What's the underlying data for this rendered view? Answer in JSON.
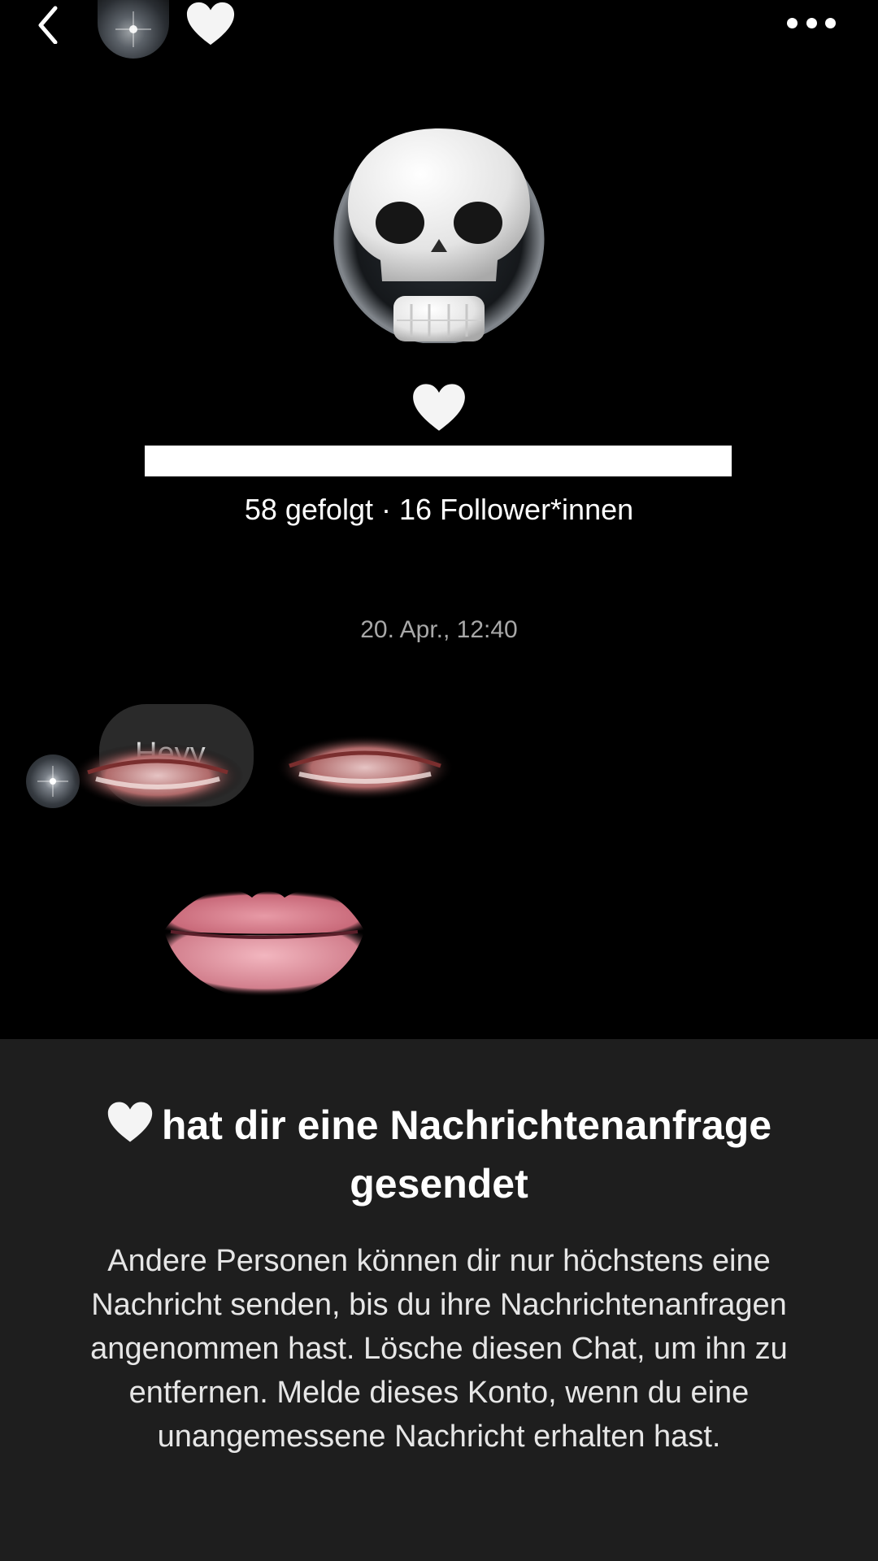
{
  "header": {
    "back_label": "back",
    "more_label": "more options"
  },
  "profile": {
    "stats": "58 gefolgt · 16 Follower*innen"
  },
  "chat": {
    "timestamp": "20. Apr., 12:40",
    "messages": [
      {
        "text": "Heyy"
      }
    ]
  },
  "request": {
    "title": "hat dir eine Nachrichtenanfrage gesendet",
    "body": "Andere Personen können dir nur höchstens eine Nachricht senden, bis du ihre Nachrichtenanfragen angenommen hast. Lösche diesen Chat, um ihn zu entfernen. Melde dieses Konto, wenn du eine unangemessene Nachricht erhalten hast."
  },
  "icons": {
    "back": "chevron-left-icon",
    "more": "ellipsis-icon",
    "heart": "white-heart-icon",
    "skull": "skull-icon"
  },
  "colors": {
    "background": "#000000",
    "panel": "#1e1e1e",
    "bubble": "#2a2a2a",
    "timestamp": "#a8a8a8"
  }
}
